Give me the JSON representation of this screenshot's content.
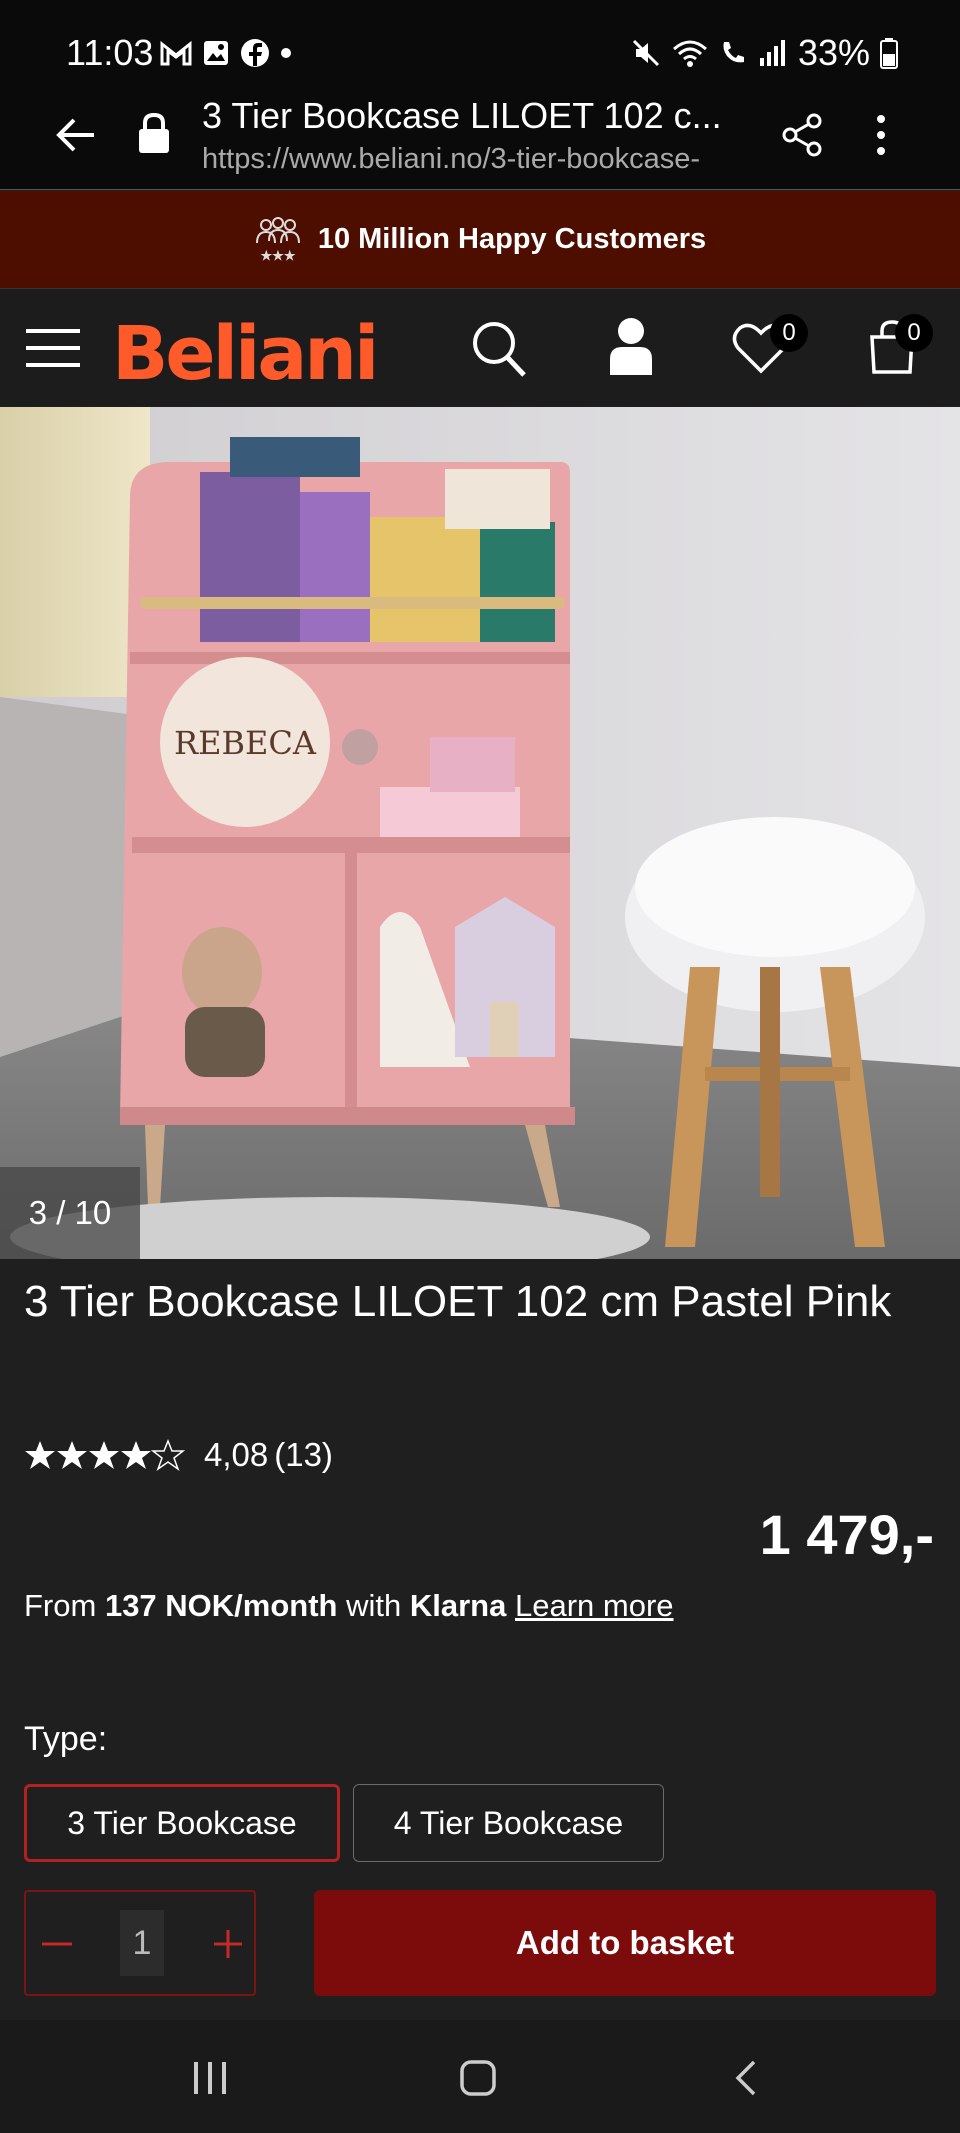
{
  "status": {
    "time": "11:03",
    "battery": "33%"
  },
  "browser": {
    "title": "3 Tier Bookcase LILOET 102 c...",
    "url": "https://www.beliani.no/3-tier-bookcase-"
  },
  "promo": {
    "text": "10 Million Happy Customers"
  },
  "header": {
    "logo": "Beliani",
    "wishlist_count": "0",
    "cart_count": "0"
  },
  "gallery": {
    "counter": "3 / 10"
  },
  "product": {
    "title": "3 Tier Bookcase LILOET 102 cm Pastel Pink",
    "rating_value": "4,08",
    "rating_count": "(13)",
    "stars": 4.08,
    "price": "1 479,-",
    "klarna_from": "From",
    "klarna_amount": "137 NOK/month",
    "klarna_with": "with",
    "klarna_brand": "Klarna",
    "klarna_link": "Learn more",
    "type_label": "Type:",
    "options": [
      "3 Tier Bookcase",
      "4 Tier Bookcase"
    ],
    "selected_option": "3 Tier Bookcase",
    "quantity": "1",
    "add_label": "Add to basket"
  },
  "colors": {
    "accent": "#ff5a2a",
    "promo_bg": "#4d0e00",
    "button": "#7c0b0b",
    "selected_border": "#b52020"
  }
}
